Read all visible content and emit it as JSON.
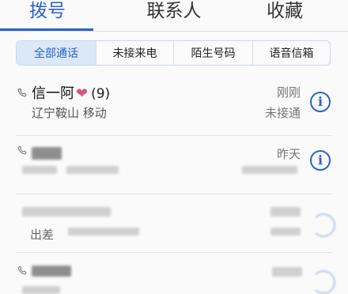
{
  "tabs": [
    {
      "label": "拨号",
      "active": true
    },
    {
      "label": "联系人",
      "active": false
    },
    {
      "label": "收藏",
      "active": false
    }
  ],
  "filters": [
    {
      "label": "全部通话",
      "active": true
    },
    {
      "label": "未接来电",
      "active": false
    },
    {
      "label": "陌生号码",
      "active": false
    },
    {
      "label": "语音信箱",
      "active": false
    }
  ],
  "calls": [
    {
      "name": "信一阿",
      "count": "(9)",
      "location": "辽宁鞍山 移动",
      "time": "刚刚",
      "status": "未接通",
      "favorite": true
    },
    {
      "time": "昨天"
    },
    {
      "location_prefix": "出差"
    }
  ],
  "colors": {
    "accent": "#2a62c9",
    "heart": "#d2577c"
  },
  "icons": {
    "info": "ⓘ",
    "heart": "❤"
  }
}
